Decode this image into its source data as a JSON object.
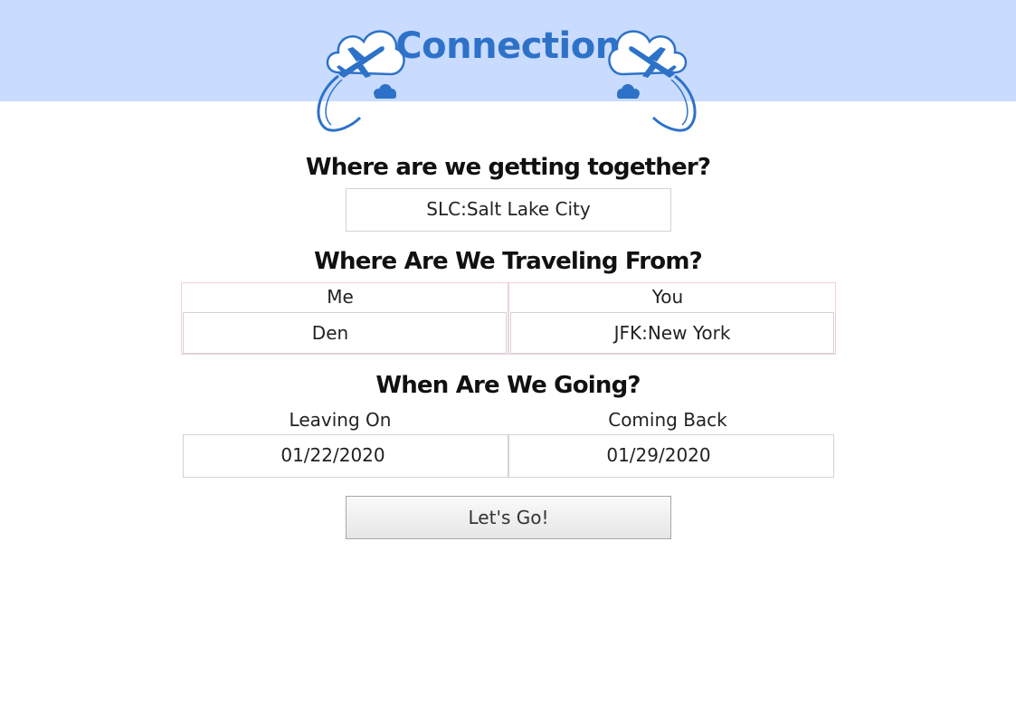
{
  "header": {
    "title": "Connection",
    "band_color": "#c9dbff",
    "title_color": "#2d72c8",
    "logo_icon": "airplane-cloud-icon"
  },
  "destination": {
    "heading": "Where are we getting together?",
    "value": "SLC:Salt Lake City"
  },
  "origins": {
    "heading": "Where Are We Traveling From?",
    "me_label": "Me",
    "you_label": "You",
    "me_value": "Den",
    "you_value": "JFK:New York"
  },
  "dates": {
    "heading": "When Are We Going?",
    "leaving_label": "Leaving On",
    "returning_label": "Coming Back",
    "leaving_value": "01/22/2020",
    "returning_value": "01/29/2020"
  },
  "submit": {
    "label": "Let's Go!"
  }
}
